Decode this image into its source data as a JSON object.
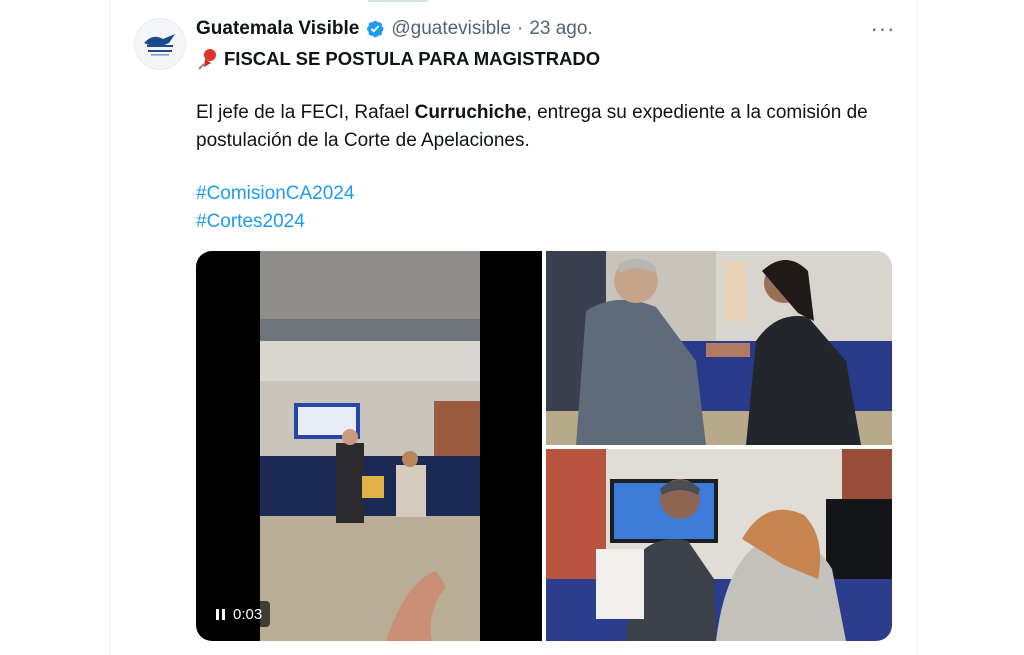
{
  "tweet": {
    "author_name": "Guatemala Visible",
    "handle": "@guatevisible",
    "separator": "·",
    "date": "23 ago.",
    "more_label": "···",
    "headline": "FISCAL SE POSTULA PARA MAGISTRADO",
    "body": {
      "part1": "El jefe de la FECI, Rafael ",
      "bold": "Curruchiche",
      "part2": ",  entrega su expediente a la comisión de postulación de la Corte de Apelaciones."
    },
    "hashtags": [
      "#ComisionCA2024",
      "#Cortes2024"
    ],
    "media": {
      "video_time": "0:03"
    }
  },
  "colors": {
    "link": "#1d9bf0",
    "verified": "#1d9bf0",
    "muted": "#536471",
    "text": "#0f1419"
  },
  "icons": {
    "verified": "verified-badge-icon",
    "pin": "pushpin-icon",
    "pause": "pause-icon",
    "more": "more-icon"
  }
}
